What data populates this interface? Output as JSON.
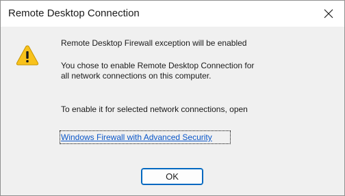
{
  "window": {
    "title": "Remote Desktop Connection",
    "close_icon": "close-icon"
  },
  "content": {
    "icon": "warning-icon",
    "heading": "Remote Desktop Firewall exception will be enabled",
    "body_line1": "You chose to enable Remote Desktop Connection for",
    "body_line2": "all network connections on this computer.",
    "instruction": "To enable it for selected network connections, open",
    "link_text": "Windows Firewall with Advanced Security"
  },
  "buttons": {
    "ok_label": "OK"
  },
  "colors": {
    "link": "#0a56c8",
    "accent": "#0067c0",
    "warning_yellow": "#f8c21c"
  }
}
